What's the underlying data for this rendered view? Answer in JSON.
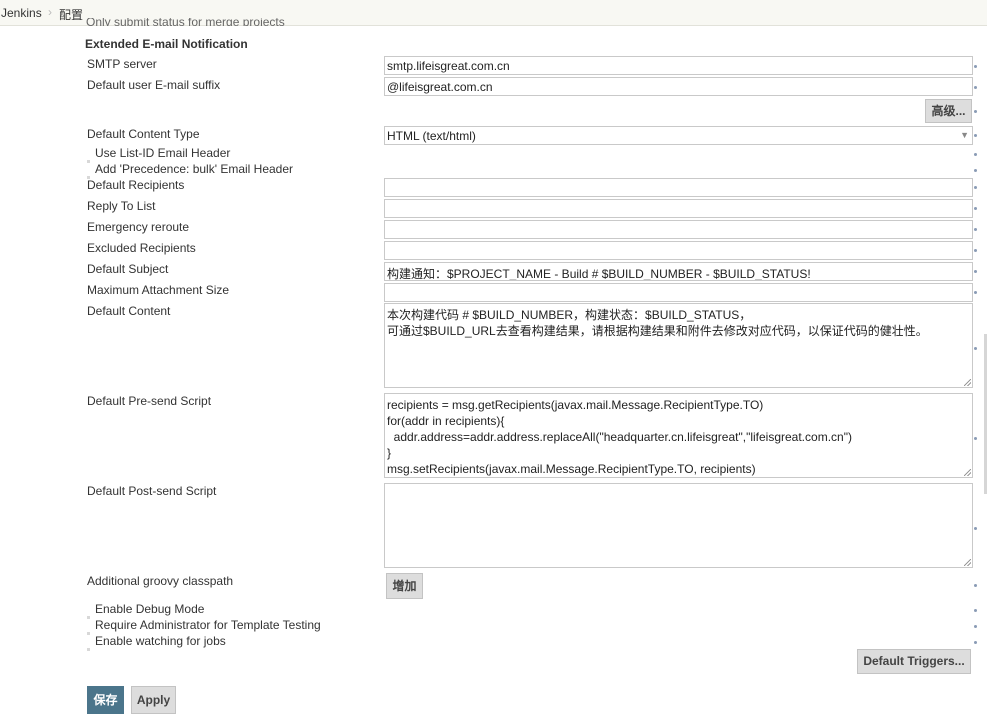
{
  "breadcrumb": {
    "home": "Jenkins",
    "page": "配置"
  },
  "clipped_text": "Only submit status for merge projects",
  "section": {
    "title": "Extended E-mail Notification"
  },
  "fields": {
    "smtp_server": {
      "label": "SMTP server",
      "value": "smtp.lifeisgreat.com.cn"
    },
    "email_suffix": {
      "label": "Default user E-mail suffix",
      "value": "@lifeisgreat.com.cn"
    },
    "content_type": {
      "label": "Default Content Type",
      "value": "HTML (text/html)"
    },
    "recipients": {
      "label": "Default Recipients",
      "value": ""
    },
    "reply_to": {
      "label": "Reply To List",
      "value": ""
    },
    "emergency": {
      "label": "Emergency reroute",
      "value": ""
    },
    "excluded": {
      "label": "Excluded Recipients",
      "value": ""
    },
    "subject": {
      "label": "Default Subject",
      "value": "构建通知：$PROJECT_NAME - Build # $BUILD_NUMBER - $BUILD_STATUS!"
    },
    "max_attach": {
      "label": "Maximum Attachment Size",
      "value": ""
    },
    "content": {
      "label": "Default Content",
      "lines": [
        "本次构建代码 # $BUILD_NUMBER，构建状态：$BUILD_STATUS，",
        "可通过$BUILD_URL去查看构建结果，请根据构建结果和附件去修改对应代码，以保证代码的健壮性。"
      ]
    },
    "presend": {
      "label": "Default Pre-send Script",
      "lines": [
        "recipients = msg.getRecipients(javax.mail.Message.RecipientType.TO)",
        "for(addr in recipients){",
        "  addr.address=addr.address.replaceAll(\"headquarter.cn.lifeisgreat\",\"lifeisgreat.com.cn\")",
        "}",
        "msg.setRecipients(javax.mail.Message.RecipientType.TO, recipients)"
      ]
    },
    "postsend": {
      "label": "Default Post-send Script",
      "lines": []
    },
    "classpath": {
      "label": "Additional groovy classpath"
    }
  },
  "checkboxes": {
    "list_id": "Use List-ID Email Header",
    "precedence": "Add 'Precedence: bulk' Email Header",
    "debug": "Enable Debug Mode",
    "require_admin": "Require Administrator for Template Testing",
    "watching": "Enable watching for jobs"
  },
  "buttons": {
    "advanced": "高级...",
    "add": "增加",
    "default_triggers": "Default Triggers...",
    "save": "保存",
    "apply": "Apply"
  },
  "colors": {
    "primary": "#4b758b",
    "topbar": "#f8f8f3",
    "help_dot": "#8a9bb5"
  }
}
